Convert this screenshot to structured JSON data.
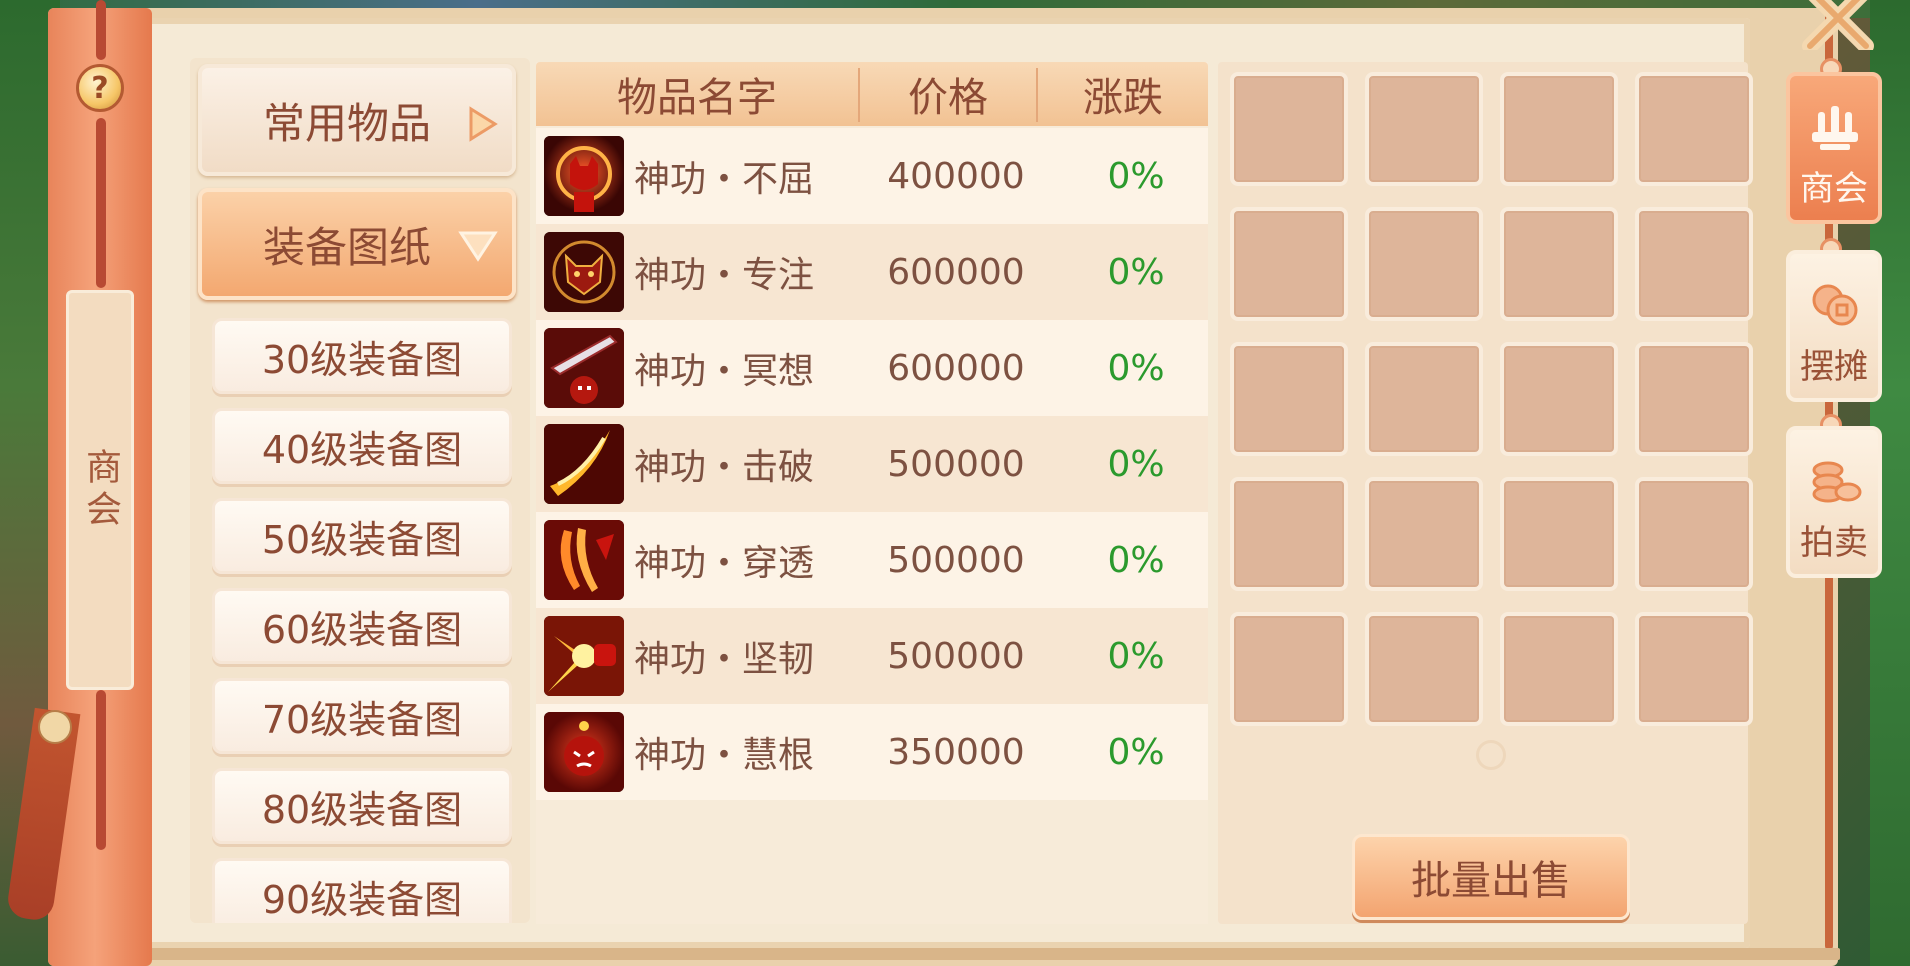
{
  "side_title": "商会",
  "help_label": "?",
  "categories": [
    {
      "label": "常用物品",
      "state": "collapsed",
      "arrow": "triangle-right"
    },
    {
      "label": "装备图纸",
      "state": "expanded",
      "arrow": "triangle-down"
    }
  ],
  "subcategories": [
    "30级装备图",
    "40级装备图",
    "50级装备图",
    "60级装备图",
    "70级装备图",
    "80级装备图",
    "90级装备图"
  ],
  "table": {
    "headers": {
      "name": "物品名字",
      "price": "价格",
      "change": "涨跌"
    },
    "rows": [
      {
        "name": "神功・不屈",
        "price": "400000",
        "change": "0%",
        "icon": "red-devil-halo-icon"
      },
      {
        "name": "神功・专注",
        "price": "600000",
        "change": "0%",
        "icon": "horned-mask-icon"
      },
      {
        "name": "神功・冥想",
        "price": "600000",
        "change": "0%",
        "icon": "sword-bear-icon"
      },
      {
        "name": "神功・击破",
        "price": "500000",
        "change": "0%",
        "icon": "slash-burst-icon"
      },
      {
        "name": "神功・穿透",
        "price": "500000",
        "change": "0%",
        "icon": "claw-strike-icon"
      },
      {
        "name": "神功・坚韧",
        "price": "500000",
        "change": "0%",
        "icon": "fist-flare-icon"
      },
      {
        "name": "神功・慧根",
        "price": "350000",
        "change": "0%",
        "icon": "angry-imp-icon"
      }
    ]
  },
  "inventory": {
    "rows": 5,
    "cols": 4
  },
  "bulk_sell_label": "批量出售",
  "right_tabs": [
    {
      "label": "商会",
      "icon": "guild-hall-icon",
      "active": true
    },
    {
      "label": "摆摊",
      "icon": "coins-icon",
      "active": false
    },
    {
      "label": "拍卖",
      "icon": "coin-stack-icon",
      "active": false
    }
  ],
  "colors": {
    "accent": "#f3a470",
    "text_brown": "#8c4a34",
    "change_green": "#2b9a2d",
    "slot": "#deb59a"
  }
}
